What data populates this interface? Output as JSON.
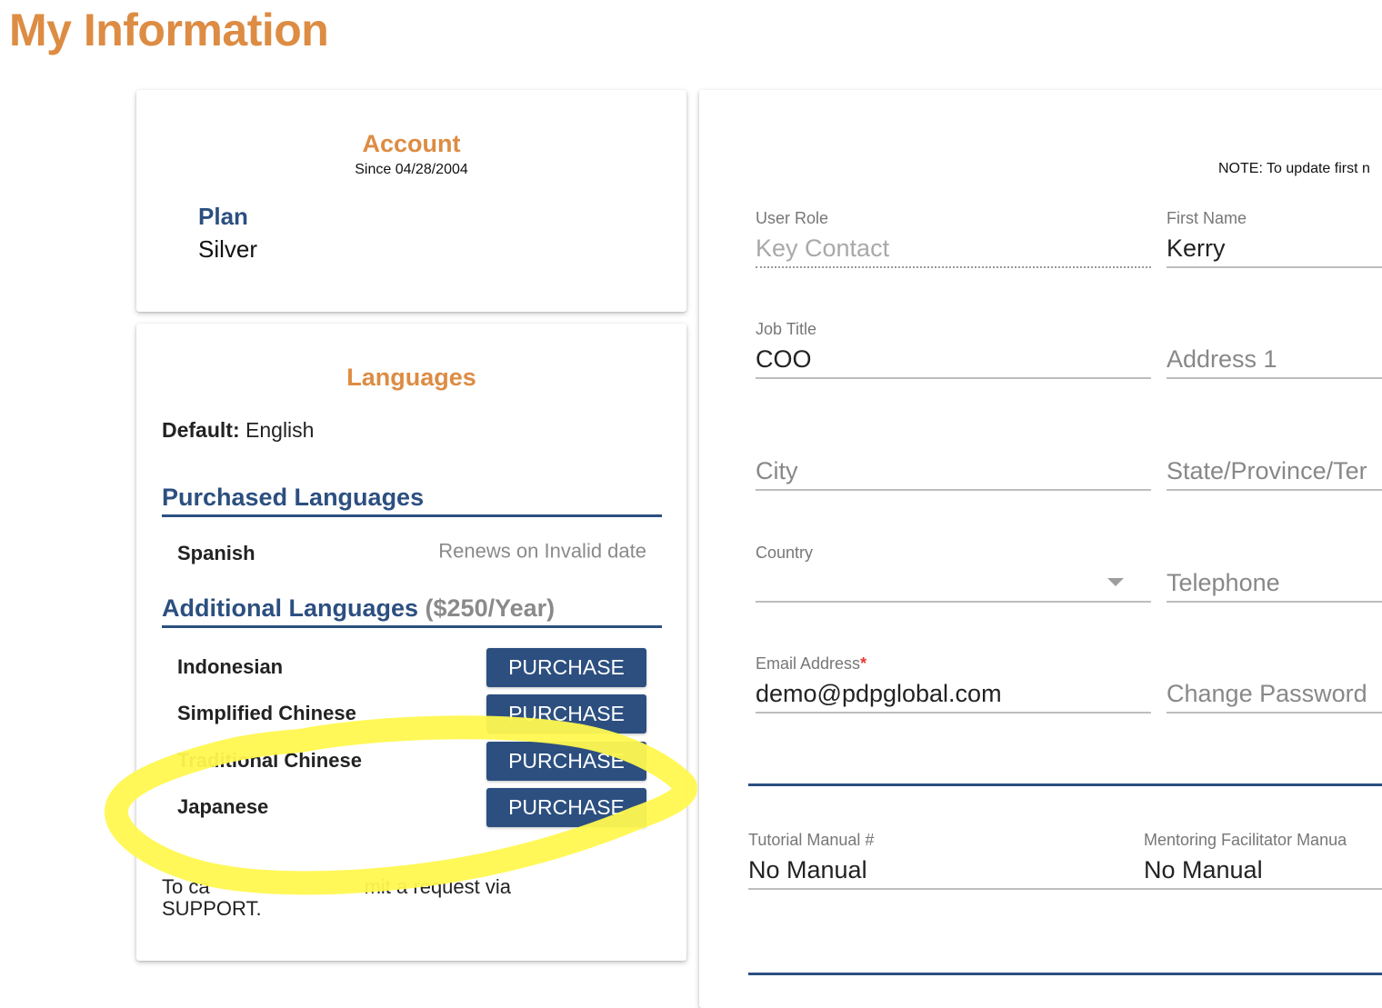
{
  "page": {
    "title": "My Information"
  },
  "account": {
    "heading": "Account",
    "since": "Since 04/28/2004",
    "plan_label": "Plan",
    "plan_value": "Silver"
  },
  "languages": {
    "heading": "Languages",
    "default_label": "Default:",
    "default_value": "English",
    "purchased_heading": "Purchased Languages",
    "purchased": [
      {
        "name": "Spanish",
        "status": "Renews on Invalid date"
      }
    ],
    "additional_heading": "Additional Languages",
    "additional_price": "($250/Year)",
    "additional": [
      {
        "name": "Indonesian",
        "button": "PURCHASE"
      },
      {
        "name": "Simplified Chinese",
        "button": "PURCHASE"
      },
      {
        "name": "Traditional Chinese",
        "button": "PURCHASE"
      },
      {
        "name": "Japanese",
        "button": "PURCHASE"
      }
    ],
    "cancel_note_line1_start": "To ca",
    "cancel_note_line1_end": "mit a request via",
    "cancel_note_line2": "SUPPORT."
  },
  "info": {
    "note": "NOTE: To update first n",
    "fields": {
      "user_role": {
        "label": "User Role",
        "value": "Key Contact"
      },
      "first_name": {
        "label": "First Name",
        "value": "Kerry"
      },
      "job_title": {
        "label": "Job Title",
        "value": "COO"
      },
      "address1": {
        "label": "",
        "placeholder": "Address 1"
      },
      "city": {
        "label": "",
        "placeholder": "City"
      },
      "state": {
        "label": "",
        "placeholder": "State/Province/Ter"
      },
      "country": {
        "label": "Country",
        "value": ""
      },
      "telephone": {
        "label": "",
        "placeholder": "Telephone"
      },
      "email": {
        "label": "Email Address",
        "required_mark": "*",
        "value": "demo@pdpglobal.com"
      },
      "password": {
        "label": "",
        "placeholder": "Change Password"
      },
      "tutorial_manual": {
        "label": "Tutorial Manual #",
        "value": "No Manual"
      },
      "mentoring_manual": {
        "label": "Mentoring Facilitator Manua",
        "value": "No Manual"
      }
    }
  },
  "colors": {
    "accent_orange": "#dd8c43",
    "brand_blue": "#2c4f80",
    "annotation_yellow": "#fff84f"
  }
}
